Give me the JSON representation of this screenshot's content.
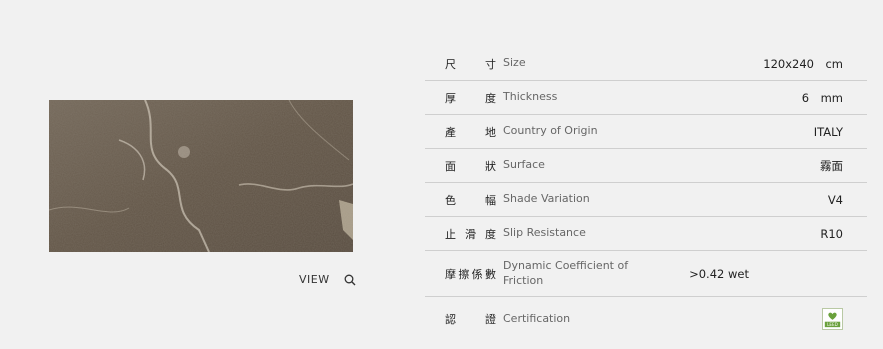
{
  "view": {
    "label": "VIEW"
  },
  "icons": {
    "view": "search-icon",
    "certification": "leed-certification-icon"
  },
  "colors": {
    "background": "#f1f1f1",
    "row_divider": "#cfcfcf",
    "stone_base": "#6b5d4e",
    "leed_green": "#6aa13c"
  },
  "specs": [
    {
      "zh": [
        "尺",
        "寸"
      ],
      "en": "Size",
      "value": "120x240　cm"
    },
    {
      "zh": [
        "厚",
        "度"
      ],
      "en": "Thickness",
      "value": "6　mm"
    },
    {
      "zh": [
        "產",
        "地"
      ],
      "en": "Country of Origin",
      "value": "ITALY"
    },
    {
      "zh": [
        "面",
        "狀"
      ],
      "en": "Surface",
      "value": "霧面"
    },
    {
      "zh": [
        "色",
        "幅"
      ],
      "en": "Shade Variation",
      "value": "V4"
    },
    {
      "zh": [
        "止",
        "滑",
        "度"
      ],
      "en": "Slip Resistance",
      "value": "R10"
    },
    {
      "zh": [
        "摩",
        "擦",
        "係",
        "數"
      ],
      "en": "Dynamic Coefficient of Friction",
      "value": ">0.42 wet"
    },
    {
      "zh": [
        "認",
        "證"
      ],
      "en": "Certification",
      "value": ""
    }
  ],
  "leed_badge_text": "LEED"
}
